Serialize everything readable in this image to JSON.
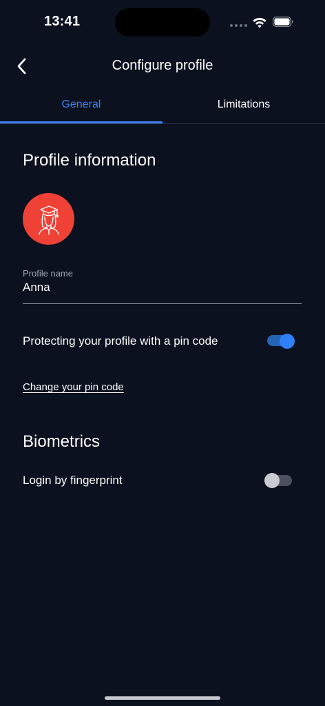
{
  "status_bar": {
    "time": "13:41"
  },
  "header": {
    "title": "Configure profile",
    "back_icon": "chevron-left-icon"
  },
  "tabs": [
    {
      "label": "General",
      "active": true
    },
    {
      "label": "Limitations",
      "active": false
    }
  ],
  "colors": {
    "background": "#0b111e",
    "accent": "#3b82f6",
    "avatar_bg": "#ef4136"
  },
  "profile_information": {
    "title": "Profile information",
    "avatar_icon": "graduate-avatar-icon",
    "name_label": "Profile name",
    "name_value": "Anna",
    "pin_toggle_label": "Protecting your profile with a pin code",
    "pin_toggle_on": true,
    "change_pin_link": "Change your pin code"
  },
  "biometrics": {
    "title": "Biometrics",
    "fingerprint_label": "Login by fingerprint",
    "fingerprint_on": false
  }
}
